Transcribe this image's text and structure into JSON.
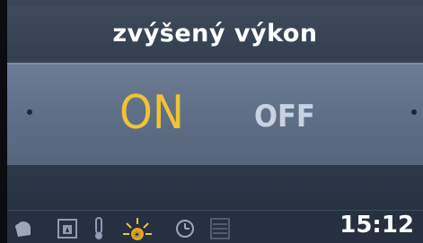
{
  "header": {
    "title": "zvýšený výkon"
  },
  "selector": {
    "options": [
      {
        "label": "ON",
        "selected": true
      },
      {
        "label": "OFF",
        "selected": false
      }
    ],
    "colors": {
      "selected": "#f2c232",
      "unselected": "#c8d2e2"
    }
  },
  "status_bar": {
    "icons": [
      "glove-icon",
      "fireplace-icon",
      "thermometer-icon",
      "sun-icon",
      "timer-icon",
      "menu-lines-icon"
    ],
    "time": "15:12"
  }
}
